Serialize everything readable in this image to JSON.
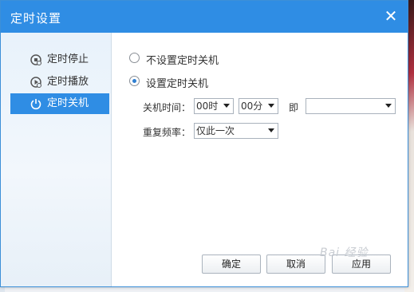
{
  "dialog": {
    "title": "定时设置",
    "close_glyph": "✕"
  },
  "sidebar": {
    "items": [
      {
        "label": "定时停止",
        "icon": "timer-stop-icon",
        "active": false
      },
      {
        "label": "定时播放",
        "icon": "timer-play-icon",
        "active": false
      },
      {
        "label": "定时关机",
        "icon": "power-icon",
        "active": true
      }
    ]
  },
  "shutdown": {
    "option_none": "不设置定时关机",
    "option_set": "设置定时关机",
    "selected": "option_set",
    "time_label": "关机时间：",
    "hour_value": "00时",
    "minute_value": "00分",
    "date_label": "即",
    "date_value": "",
    "repeat_label": "重复频率：",
    "repeat_value": "仅此一次"
  },
  "buttons": {
    "ok": "确定",
    "cancel": "取消",
    "apply": "应用"
  },
  "watermark": "Bai 经验",
  "colors": {
    "titlebar": "#2f8de4",
    "active_item": "#2f8de4"
  }
}
